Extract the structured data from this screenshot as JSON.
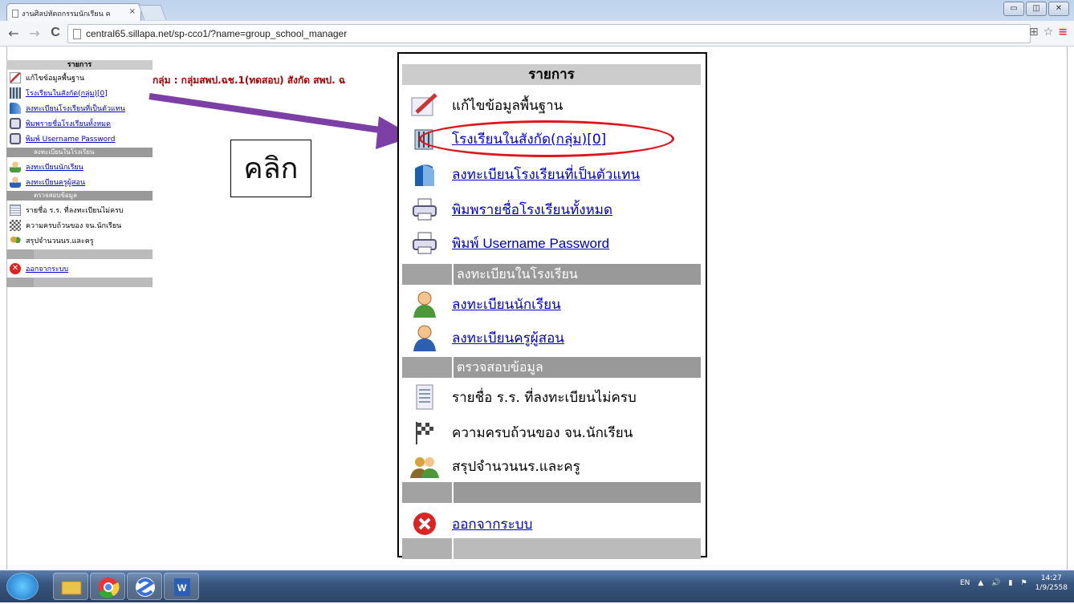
{
  "browser": {
    "tab_title": "งานศิลปหัตถกรรมนักเรียน ค",
    "tab_close": "×",
    "url": "central65.sillapa.net/sp-cco1/?name=group_school_manager",
    "back": "←",
    "forward": "→",
    "reload": "C",
    "star": "☆",
    "menu": "≡",
    "translate": "⊞",
    "win_min": "▭",
    "win_max": "◫",
    "win_close": "✕"
  },
  "left_menu": {
    "header": "รายการ",
    "items": [
      {
        "label": "แก้ไขข้อมูลพื้นฐาน",
        "link": false
      },
      {
        "label": "โรงเรียนในสังกัด(กลุ่ม)[0]",
        "link": true
      },
      {
        "label": "ลงทะเบียนโรงเรียนที่เป็นตัวแทน",
        "link": true
      },
      {
        "label": "พิมพรายชื่อโรงเรียนทั้งหมด",
        "link": true
      },
      {
        "label": "พิมพ์ Username Password",
        "link": true
      }
    ],
    "section_register": "ลงทะเบียนในโรงเรียน",
    "register_items": [
      {
        "label": "ลงทะเบียนนักเรียน"
      },
      {
        "label": "ลงทะเบียนครูผู้สอน"
      }
    ],
    "section_check": "ตรวจสอบข้อมูล",
    "check_items": [
      {
        "label": "รายชื่อ ร.ร. ที่ลงทะเบียนไม่ครบ"
      },
      {
        "label": "ความครบถ้วนของ จน.นักเรียน"
      },
      {
        "label": "สรุปจำนวนนร.และครู"
      }
    ],
    "logout": "ออกจากระบบ"
  },
  "group_title": "กลุ่ม : กลุ่มสพป.ฉช.1(ทดสอบ) สังกัด สพป. ฉ",
  "click_label": "คลิก",
  "zoom": {
    "header": "รายการ",
    "edit": "แก้ไขข้อมูลพื้นฐาน",
    "schools": "โรงเรียนในสังกัด(กลุ่ม)[0]",
    "represent": "ลงทะเบียนโรงเรียนที่เป็นตัวแทน",
    "print_list": "พิมพรายชื่อโรงเรียนทั้งหมด",
    "print_user": "พิมพ์ Username Password",
    "section_register": "ลงทะเบียนในโรงเรียน",
    "students": "ลงทะเบียนนักเรียน",
    "teachers": "ลงทะเบียนครูผู้สอน",
    "section_check": "ตรวจสอบข้อมูล",
    "incomplete": "รายชื่อ ร.ร. ที่ลงทะเบียนไม่ครบ",
    "completeness": "ความครบถ้วนของ จน.นักเรียน",
    "summary": "สรุปจำนวนนร.และครู",
    "logout": "ออกจากระบบ"
  },
  "taskbar": {
    "lang": "EN",
    "time": "14:27",
    "date": "1/9/2558"
  },
  "colors": {
    "annotation_red": "#e0141b",
    "arrow_purple": "#7b3fa6",
    "link_blue": "#0000cc"
  }
}
